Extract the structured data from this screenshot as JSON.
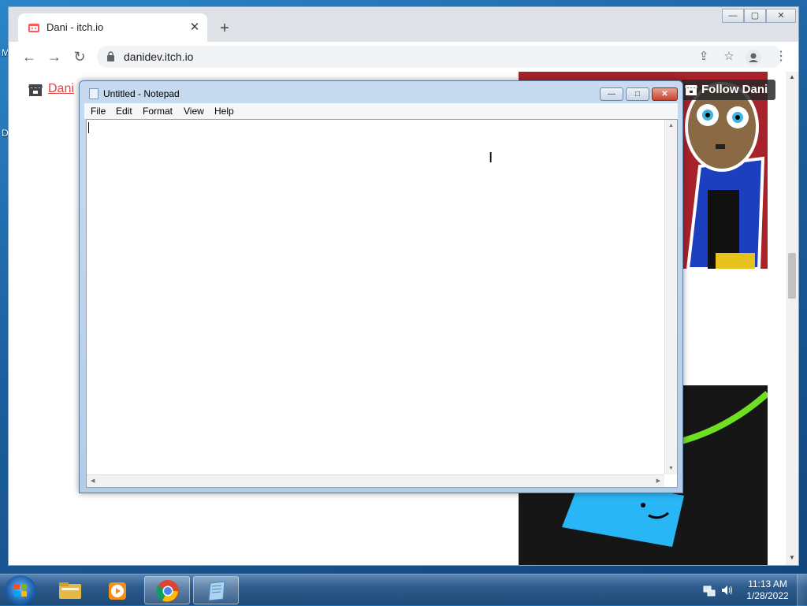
{
  "desktop": {
    "icon_labels": [
      "M",
      "D"
    ]
  },
  "browser": {
    "tab": {
      "title": "Dani - itch.io",
      "close_glyph": "✕"
    },
    "new_tab_glyph": "+",
    "window_controls": {
      "minimize": "—",
      "maximize": "▢",
      "close": "✕"
    },
    "toolbar": {
      "back": "←",
      "forward": "→",
      "reload": "↻",
      "url": "danidev.itch.io"
    },
    "page": {
      "site_link": "Dani",
      "follow_button": "Follow Dani"
    }
  },
  "notepad": {
    "title": "Untitled - Notepad",
    "menu": [
      "File",
      "Edit",
      "Format",
      "View",
      "Help"
    ],
    "content": "",
    "buttons": {
      "minimize": "—",
      "maximize": "□",
      "close": "✕"
    }
  },
  "cursor": {
    "glyph": "I"
  },
  "taskbar": {
    "clock_time": "11:13 AM",
    "clock_date": "1/28/2022",
    "pinned": [
      "file-explorer",
      "media-player",
      "chrome",
      "notepad"
    ]
  }
}
